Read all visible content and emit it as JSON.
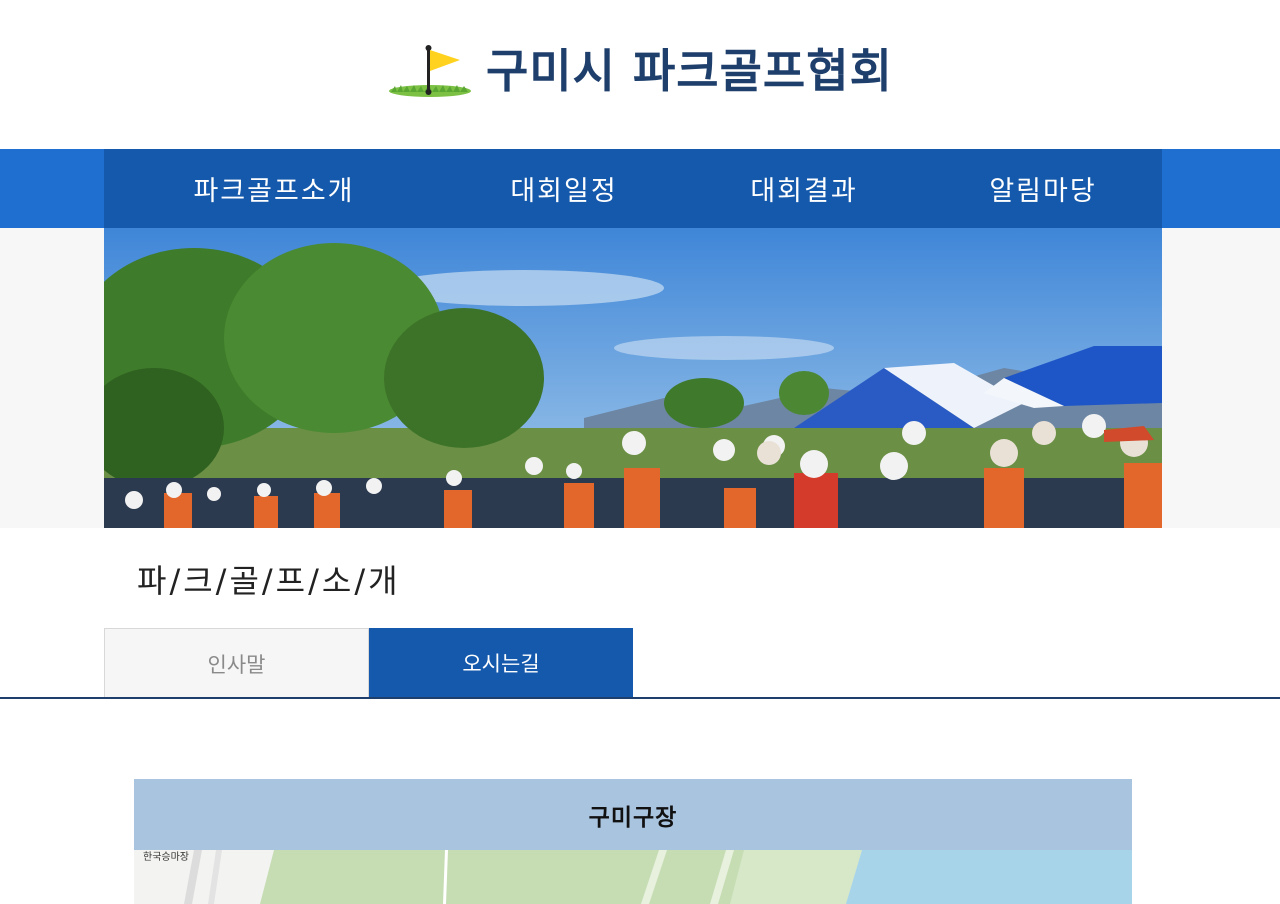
{
  "header": {
    "logo_icon": "golf-flag-icon",
    "title": "구미시 파크골프협회"
  },
  "nav": {
    "items": [
      {
        "label": "파크골프소개"
      },
      {
        "label": "대회일정"
      },
      {
        "label": "대회결과"
      },
      {
        "label": "알림마당"
      }
    ]
  },
  "section": {
    "title": "파/크/골/프/소/개"
  },
  "tabs": [
    {
      "label": "인사말",
      "active": false
    },
    {
      "label": "오시는길",
      "active": true
    }
  ],
  "map": {
    "heading": "구미구장",
    "place_label": "한국승마장"
  },
  "colors": {
    "title": "#1e3f6c",
    "nav_band": "#1f6fd0",
    "nav_inner": "#1459ac",
    "map_header": "#a9c4df"
  }
}
